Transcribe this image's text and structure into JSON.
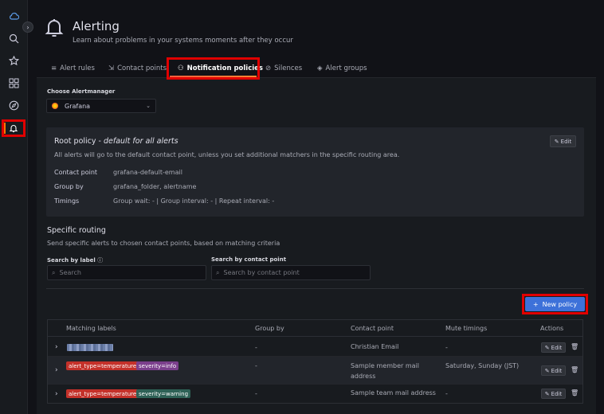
{
  "sidebar": {
    "icons": [
      "cloud-icon",
      "search-icon",
      "star-icon",
      "dashboard-grid-icon",
      "compass-icon",
      "bell-icon"
    ]
  },
  "header": {
    "title": "Alerting",
    "subtitle": "Learn about problems in your systems moments after they occur"
  },
  "tabs": [
    {
      "label": "Alert rules"
    },
    {
      "label": "Contact points"
    },
    {
      "label": "Notification policies"
    },
    {
      "label": "Silences"
    },
    {
      "label": "Alert groups"
    }
  ],
  "alertmanager": {
    "label": "Choose Alertmanager",
    "selected": "Grafana"
  },
  "root_policy": {
    "title": "Root policy - ",
    "title_em": "default for all alerts",
    "description": "All alerts will go to the default contact point, unless you set additional matchers in the specific routing area.",
    "edit_label": "Edit",
    "fields": [
      {
        "label": "Contact point",
        "value": "grafana-default-email"
      },
      {
        "label": "Group by",
        "value": "grafana_folder, alertname"
      },
      {
        "label": "Timings",
        "value": "Group wait: - | Group interval: - | Repeat interval: -"
      }
    ]
  },
  "specific_routing": {
    "title": "Specific routing",
    "description": "Send specific alerts to chosen contact points, based on matching criteria",
    "search_label_title": "Search by label",
    "search_label_placeholder": "Search",
    "search_contact_title": "Search by contact point",
    "search_contact_placeholder": "Search by contact point",
    "new_policy_label": "New policy"
  },
  "table": {
    "headers": [
      "Matching labels",
      "Group by",
      "Contact point",
      "Mute timings",
      "Actions"
    ],
    "rows": [
      {
        "labels": [],
        "group_by": "-",
        "contact": "Christian Email",
        "contact2": "",
        "mute": "-",
        "edit": "Edit"
      },
      {
        "labels": [
          "alert_type=temperature",
          "severity=info"
        ],
        "group_by": "-",
        "contact": "Sample member mail",
        "contact2": "address",
        "mute": "Saturday, Sunday (JST)",
        "edit": "Edit"
      },
      {
        "labels": [
          "alert_type=temperature",
          "severity=warning"
        ],
        "group_by": "-",
        "contact": "Sample team mail address",
        "contact2": "",
        "mute": "-",
        "edit": "Edit"
      }
    ]
  }
}
